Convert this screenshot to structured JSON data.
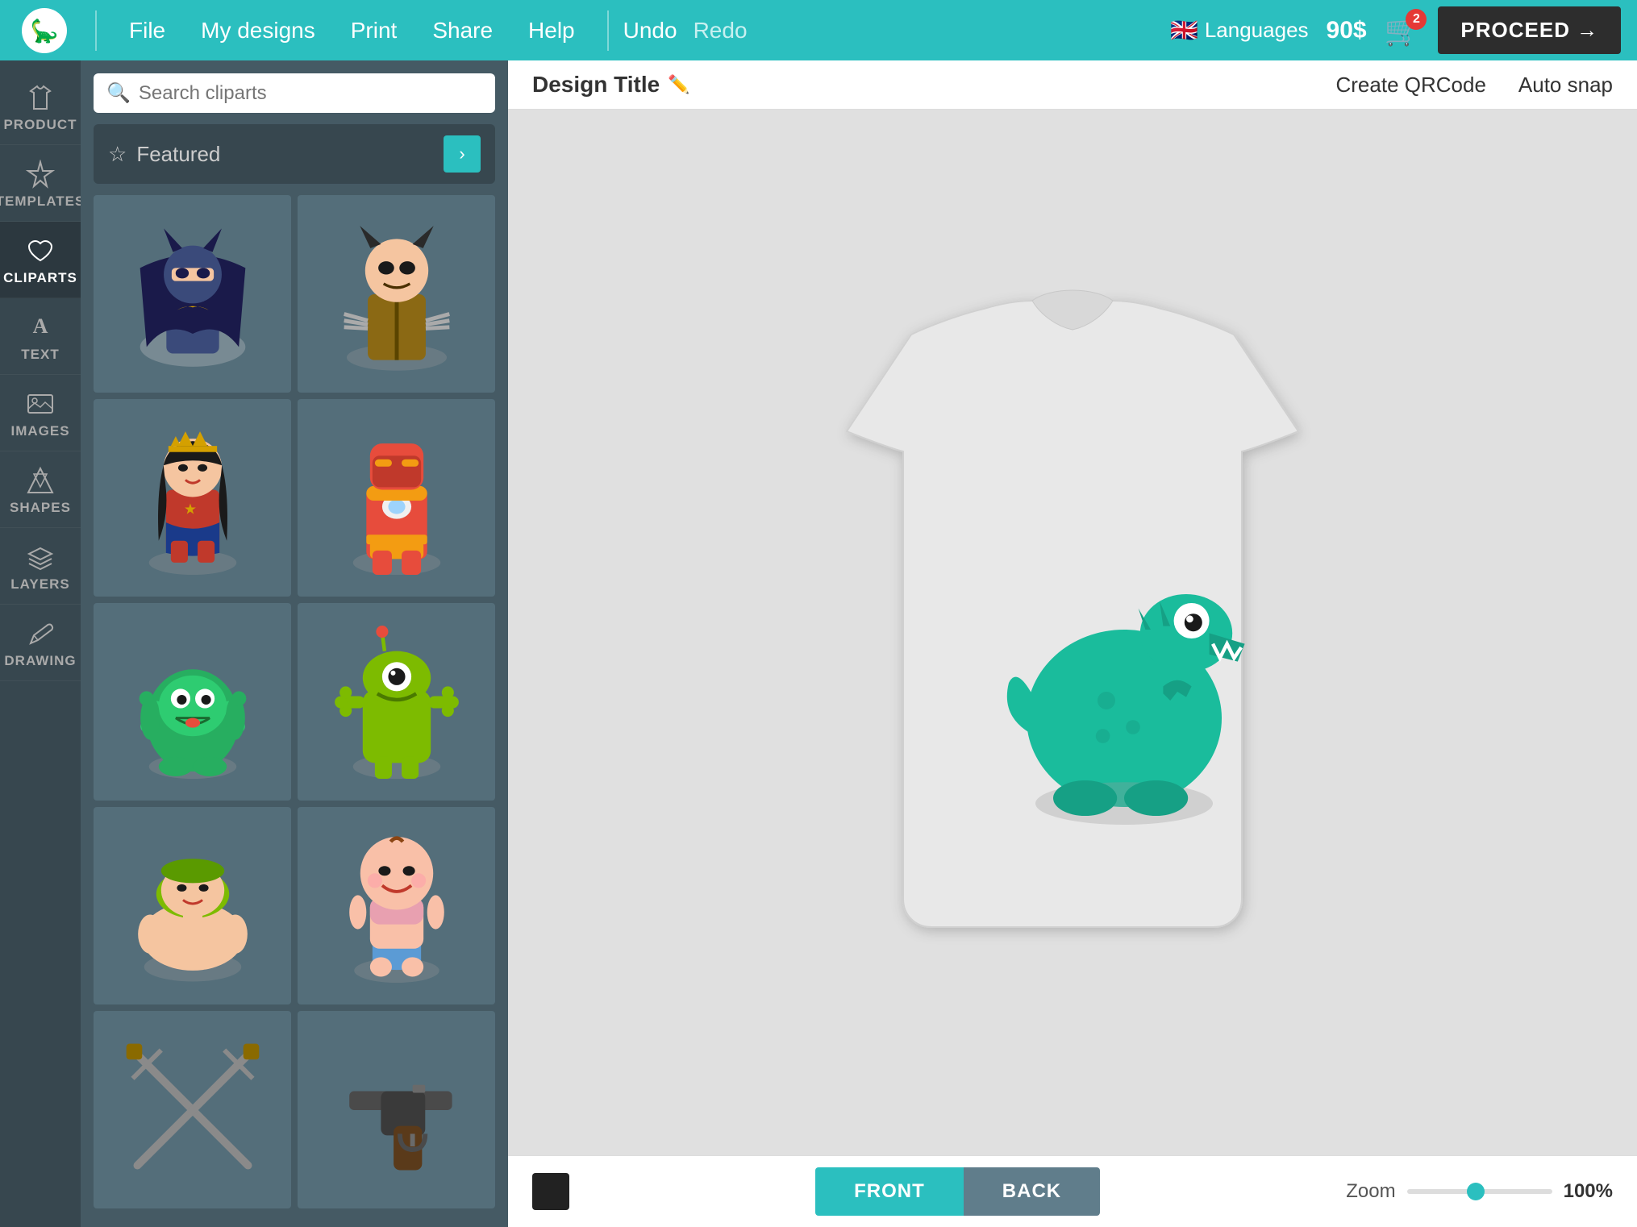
{
  "topbar": {
    "logo_alt": "Printful logo",
    "nav_items": [
      "File",
      "My designs",
      "Print",
      "Share",
      "Help"
    ],
    "undo_label": "Undo",
    "redo_label": "Redo",
    "language_label": "Languages",
    "price": "90$",
    "cart_count": "2",
    "proceed_label": "PROCEED"
  },
  "sidebar": {
    "items": [
      {
        "id": "product",
        "label": "PRODUCT",
        "icon": "shirt"
      },
      {
        "id": "templates",
        "label": "TEMPLATES",
        "icon": "star"
      },
      {
        "id": "cliparts",
        "label": "CLIPARTS",
        "icon": "heart",
        "active": true
      },
      {
        "id": "text",
        "label": "TEXT",
        "icon": "text"
      },
      {
        "id": "images",
        "label": "IMAGES",
        "icon": "image"
      },
      {
        "id": "shapes",
        "label": "SHAPES",
        "icon": "diamond"
      },
      {
        "id": "layers",
        "label": "LAYERS",
        "icon": "layers"
      },
      {
        "id": "drawing",
        "label": "DRAWING",
        "icon": "drawing"
      }
    ]
  },
  "cliparts_panel": {
    "search_placeholder": "Search cliparts",
    "featured_label": "Featured",
    "cliparts": [
      {
        "id": 1,
        "name": "Batman",
        "color": "#4a6b9a"
      },
      {
        "id": 2,
        "name": "Wolverine",
        "color": "#3d3d3d"
      },
      {
        "id": 3,
        "name": "Wonder Woman",
        "color": "#c0392b"
      },
      {
        "id": 4,
        "name": "Iron Man",
        "color": "#e74c3c"
      },
      {
        "id": 5,
        "name": "Green Monster",
        "color": "#27ae60"
      },
      {
        "id": 6,
        "name": "Alien Monster",
        "color": "#2ecc71"
      },
      {
        "id": 7,
        "name": "Bald Man",
        "color": "#f5cba7"
      },
      {
        "id": 8,
        "name": "Baby",
        "color": "#f9a7a7"
      },
      {
        "id": 9,
        "name": "Swords",
        "color": "#95a5a6"
      },
      {
        "id": 10,
        "name": "Gun",
        "color": "#7f8c8d"
      }
    ]
  },
  "canvas": {
    "design_title": "Design Title",
    "create_qr_label": "Create QRCode",
    "auto_snap_label": "Auto snap",
    "front_label": "FRONT",
    "back_label": "BACK",
    "zoom_label": "Zoom",
    "zoom_value": "100%",
    "color": "#222222"
  }
}
